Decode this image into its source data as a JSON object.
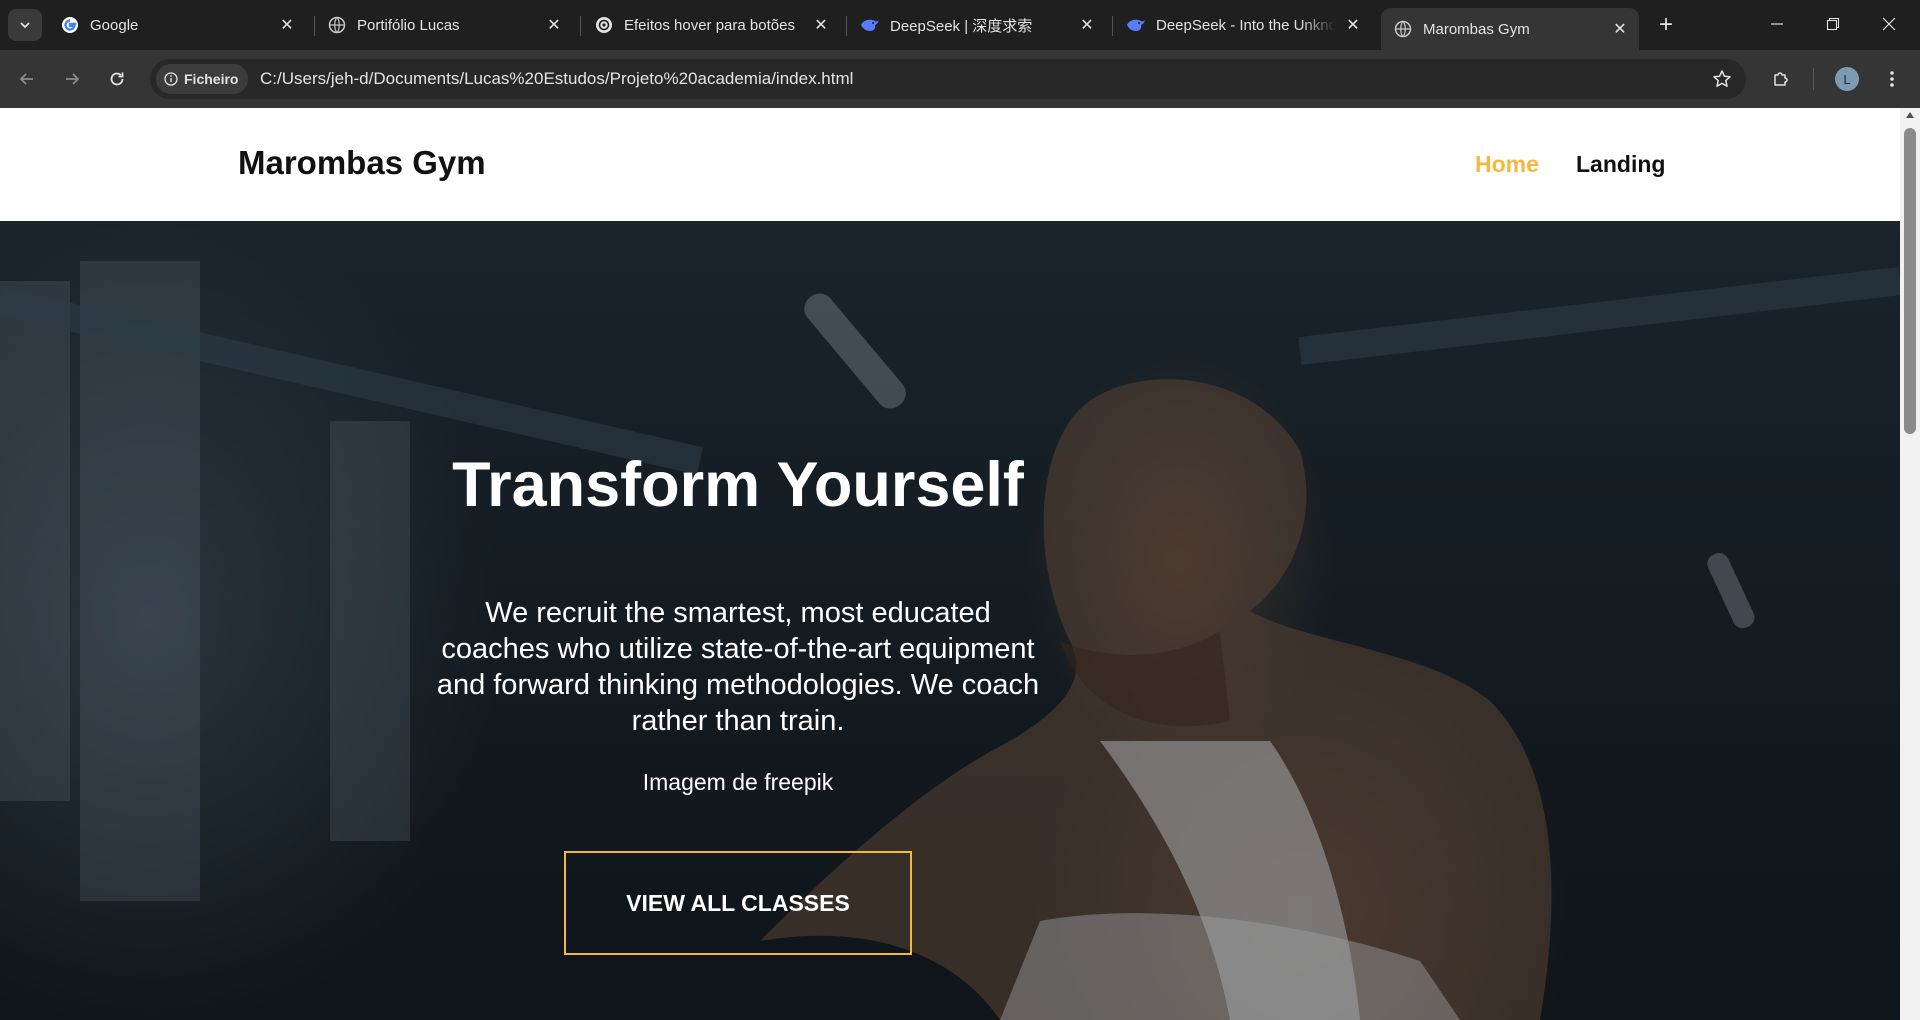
{
  "browser": {
    "tabs": [
      {
        "title": "Google",
        "favicon": "google-icon"
      },
      {
        "title": "Portifólio Lucas",
        "favicon": "globe-icon"
      },
      {
        "title": "Efeitos hover para botões",
        "favicon": "openai-icon"
      },
      {
        "title": "DeepSeek | 深度求索",
        "favicon": "deepseek-icon"
      },
      {
        "title": "DeepSeek - Into the Unknown",
        "favicon": "deepseek-icon"
      },
      {
        "title": "Marombas Gym",
        "favicon": "globe-icon",
        "active": true
      }
    ],
    "address": {
      "chip_label": "Ficheiro",
      "url": "C:/Users/jeh-d/Documents/Lucas%20Estudos/Projeto%20academia/index.html"
    },
    "profile_initial": "L"
  },
  "site": {
    "logo": "Marombas Gym",
    "nav": {
      "home": "Home",
      "landing": "Landing"
    },
    "hero": {
      "title": "Transform Yourself",
      "text": "We recruit the smartest, most educated coaches who utilize state-of-the-art equipment and forward thinking methodologies. We coach rather than train.",
      "credit": "Imagem de freepik",
      "button": "VIEW ALL CLASSES"
    }
  },
  "colors": {
    "accent": "#f5b83d",
    "browser_dark": "#1f1f1f",
    "toolbar": "#353535"
  }
}
